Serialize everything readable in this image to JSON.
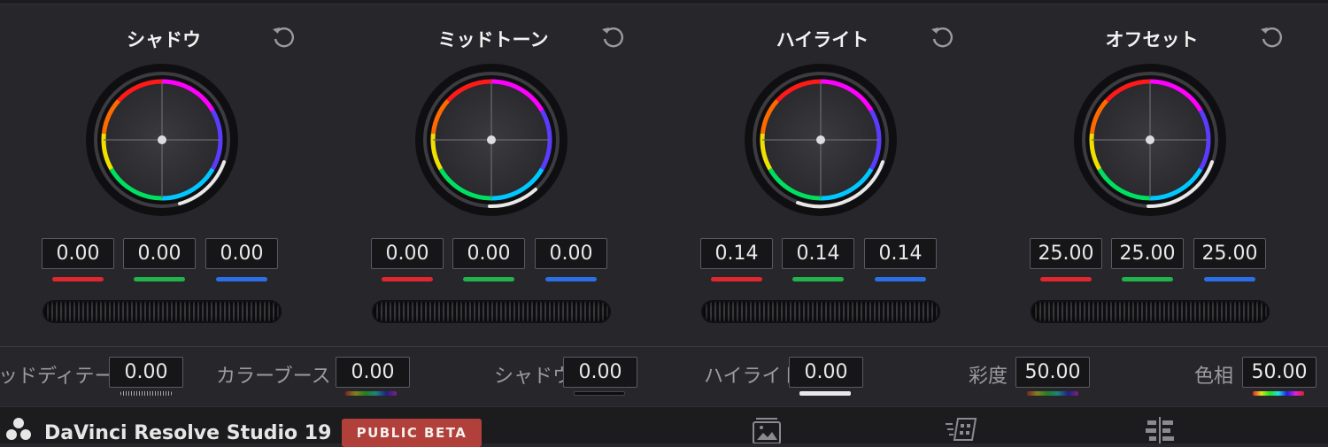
{
  "wheels": [
    {
      "title": "シャドウ",
      "values": [
        "0.00",
        "0.00",
        "0.00"
      ]
    },
    {
      "title": "ミッドトーン",
      "values": [
        "0.00",
        "0.00",
        "0.00"
      ]
    },
    {
      "title": "ハイライト",
      "values": [
        "0.14",
        "0.14",
        "0.14"
      ]
    },
    {
      "title": "オフセット",
      "values": [
        "25.00",
        "25.00",
        "25.00"
      ]
    }
  ],
  "params": [
    {
      "label": "ッドディテール",
      "value": "0.00"
    },
    {
      "label": "カラーブースト",
      "value": "0.00"
    },
    {
      "label": "シャドウ",
      "value": "0.00"
    },
    {
      "label": "ハイライト",
      "value": "0.00"
    },
    {
      "label": "彩度",
      "value": "50.00"
    },
    {
      "label": "色相",
      "value": "50.00"
    }
  ],
  "footer": {
    "app_name": "DaVinci Resolve Studio 19",
    "badge": "PUBLIC BETA",
    "page_icons": [
      "media-page-icon",
      "cut-page-icon",
      "edit-page-icon"
    ]
  },
  "colors": {
    "background": "#27272b",
    "red": "#e0272e",
    "green": "#22b34b",
    "blue": "#2b6fe6",
    "beta_badge": "#b1403a"
  }
}
